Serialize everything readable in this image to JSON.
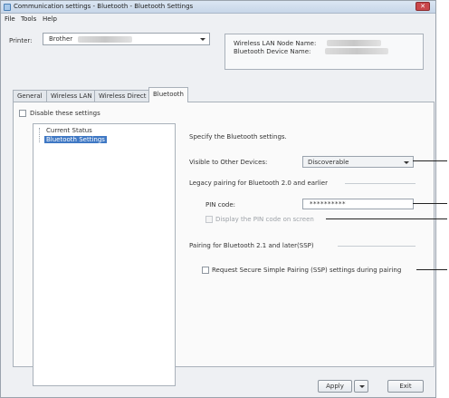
{
  "window": {
    "title": "Communication settings - Bluetooth - Bluetooth Settings",
    "close_label": "✕"
  },
  "menu": [
    "File",
    "Tools",
    "Help"
  ],
  "printer": {
    "label": "Printer:",
    "value": "Brother"
  },
  "info": {
    "lan_label": "Wireless LAN Node Name:",
    "bt_label": "Bluetooth Device Name:"
  },
  "tabs": [
    {
      "label": "General"
    },
    {
      "label": "Wireless LAN"
    },
    {
      "label": "Wireless Direct"
    },
    {
      "label": "Bluetooth",
      "active": true
    }
  ],
  "disable_settings": {
    "label": "Disable these settings",
    "checked": false
  },
  "tree": {
    "items": [
      "Current Status",
      "Bluetooth Settings"
    ],
    "selected_index": 1
  },
  "settings": {
    "heading": "Specify the Bluetooth settings.",
    "visible_label": "Visible to Other Devices:",
    "visible_value": "Discoverable",
    "legacy_heading": "Legacy pairing for Bluetooth 2.0 and earlier",
    "pin_label": "PIN code:",
    "pin_value": "**********",
    "display_pin_label": "Display the PIN code on screen",
    "ssp_heading": "Pairing for Bluetooth 2.1 and later(SSP)",
    "ssp_label": "Request Secure Simple Pairing (SSP) settings during pairing"
  },
  "buttons": {
    "apply": "Apply",
    "exit": "Exit"
  },
  "colors": {
    "selection": "#3f78c4",
    "close_button": "#c9474b"
  }
}
